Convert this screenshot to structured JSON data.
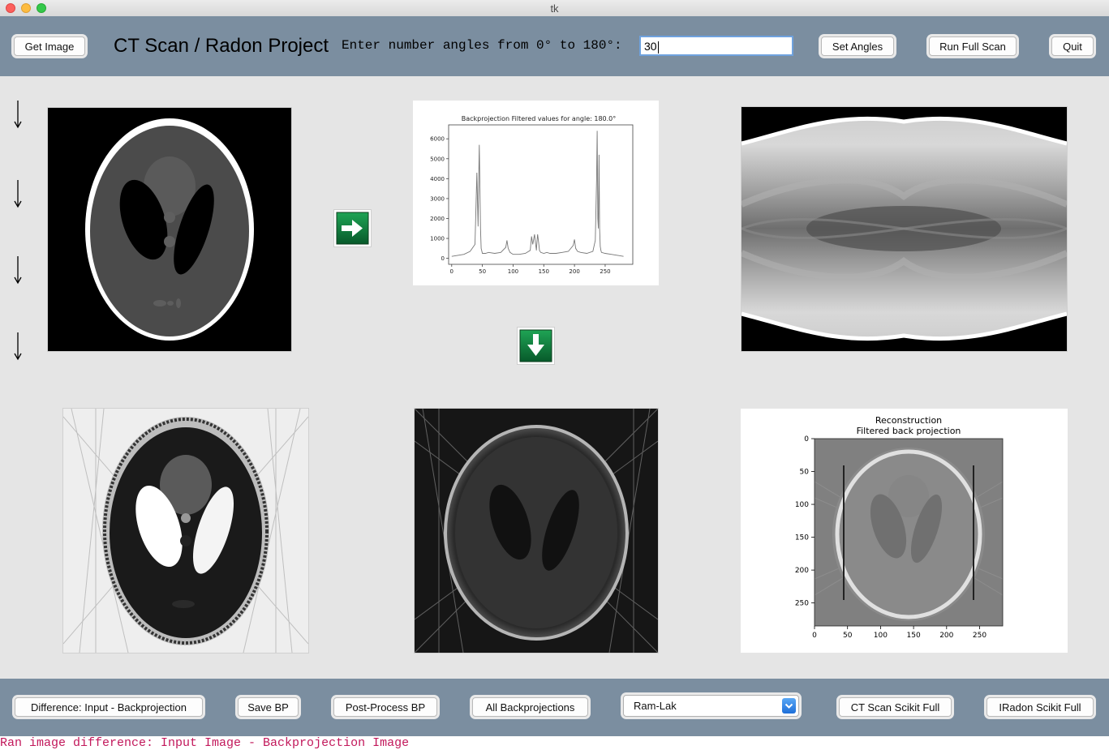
{
  "window": {
    "title": "tk"
  },
  "toolbar": {
    "get_image": "Get Image",
    "app_title": "CT Scan / Radon Project",
    "angles_prompt": "Enter number angles from 0° to 180°:",
    "angles_value": "30",
    "set_angles": "Set Angles",
    "run_full_scan": "Run Full Scan",
    "quit": "Quit"
  },
  "panels": {
    "phantom": "Shepp-Logan phantom input image",
    "sinogram": "sinogram image",
    "difference": "difference image",
    "backprojection": "backprojection image"
  },
  "profile_chart": {
    "title": "Backprojection Filtered values for angle: 180.0°",
    "x_ticks": [
      "0",
      "50",
      "100",
      "150",
      "200",
      "250"
    ],
    "y_ticks": [
      "0",
      "1000",
      "2000",
      "3000",
      "4000",
      "5000",
      "6000"
    ]
  },
  "recon_chart": {
    "title_line1": "Reconstruction",
    "title_line2": "Filtered back projection",
    "x_ticks": [
      "0",
      "50",
      "100",
      "150",
      "200",
      "250"
    ],
    "y_ticks": [
      "0",
      "50",
      "100",
      "150",
      "200",
      "250"
    ]
  },
  "chart_data": {
    "type": "line",
    "title": "Backprojection Filtered values for angle: 180.0°",
    "xlabel": "",
    "ylabel": "",
    "xlim": [
      -5,
      295
    ],
    "ylim": [
      -300,
      6700
    ],
    "grid": false,
    "series": [
      {
        "x": [
          0,
          10,
          20,
          30,
          38,
          41,
          43,
          44,
          45,
          46,
          47,
          48,
          50,
          55,
          60,
          70,
          80,
          88,
          90,
          92,
          95,
          100,
          110,
          120,
          128,
          130,
          132,
          135,
          136,
          138,
          139,
          140,
          142,
          143,
          145,
          150,
          155,
          160,
          170,
          180,
          190,
          198,
          200,
          202,
          205,
          210,
          220,
          230,
          234,
          236,
          237,
          238,
          239,
          240,
          241,
          242,
          243,
          244,
          250,
          260,
          270,
          280
        ],
        "y": [
          100,
          150,
          200,
          350,
          700,
          4300,
          1600,
          4000,
          5700,
          3500,
          1500,
          500,
          250,
          250,
          300,
          250,
          300,
          550,
          900,
          500,
          300,
          200,
          200,
          250,
          400,
          1100,
          700,
          1200,
          900,
          400,
          900,
          1200,
          700,
          400,
          300,
          250,
          300,
          250,
          250,
          300,
          350,
          650,
          950,
          500,
          350,
          300,
          250,
          350,
          900,
          4000,
          6400,
          2000,
          1500,
          5200,
          1500,
          600,
          400,
          300,
          250,
          200,
          150,
          100
        ]
      }
    ]
  },
  "bottombar": {
    "difference": "Difference: Input - Backprojection",
    "save_bp": "Save BP",
    "post_process": "Post-Process BP",
    "all_backprojections": "All Backprojections",
    "filter_selected": "Ram-Lak",
    "ct_scan_scikit": "CT Scan Scikit Full",
    "iradon_scikit": "IRadon Scikit Full"
  },
  "status": {
    "message": "Ran image difference: Input Image - Backprojection Image"
  },
  "icons": {
    "next": "right-arrow-icon",
    "down": "down-arrow-icon"
  },
  "colors": {
    "toolbar_bg": "#7b8ea0",
    "status_text": "#c2185b",
    "arrow_green": "#0b7a36"
  }
}
